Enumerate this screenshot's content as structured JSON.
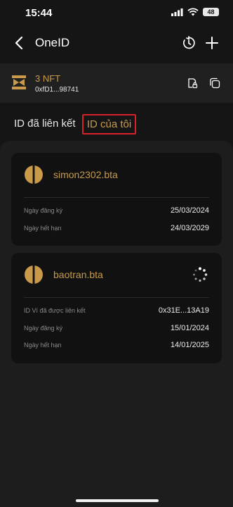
{
  "status_bar": {
    "time": "15:44",
    "battery": "48"
  },
  "header": {
    "title": "OneID"
  },
  "wallet": {
    "nft_count": "3 NFT",
    "address": "0xfD1...98741"
  },
  "tabs": {
    "linked": "ID đã liên kết",
    "mine": "ID của tôi"
  },
  "ids": [
    {
      "name": "simon2302.bta",
      "rows": [
        {
          "label": "Ngày đăng ký",
          "value": "25/03/2024"
        },
        {
          "label": "Ngày hết hạn",
          "value": "24/03/2029"
        }
      ]
    },
    {
      "name": "baotran.bta",
      "rows": [
        {
          "label": "ID Ví đã được liên kết",
          "value": "0x31E...13A19"
        },
        {
          "label": "Ngày đăng ký",
          "value": "15/01/2024"
        },
        {
          "label": "Ngày hết hạn",
          "value": "14/01/2025"
        }
      ]
    }
  ],
  "colors": {
    "accent_gold": "#c89a4a",
    "highlight_red": "#d8202a",
    "background": "#151515"
  },
  "icons": [
    "back-icon",
    "history-icon",
    "plus-icon",
    "wallet-logo-icon",
    "lock-document-icon",
    "copy-icon",
    "id-logo-icon",
    "loading-spinner-icon"
  ]
}
